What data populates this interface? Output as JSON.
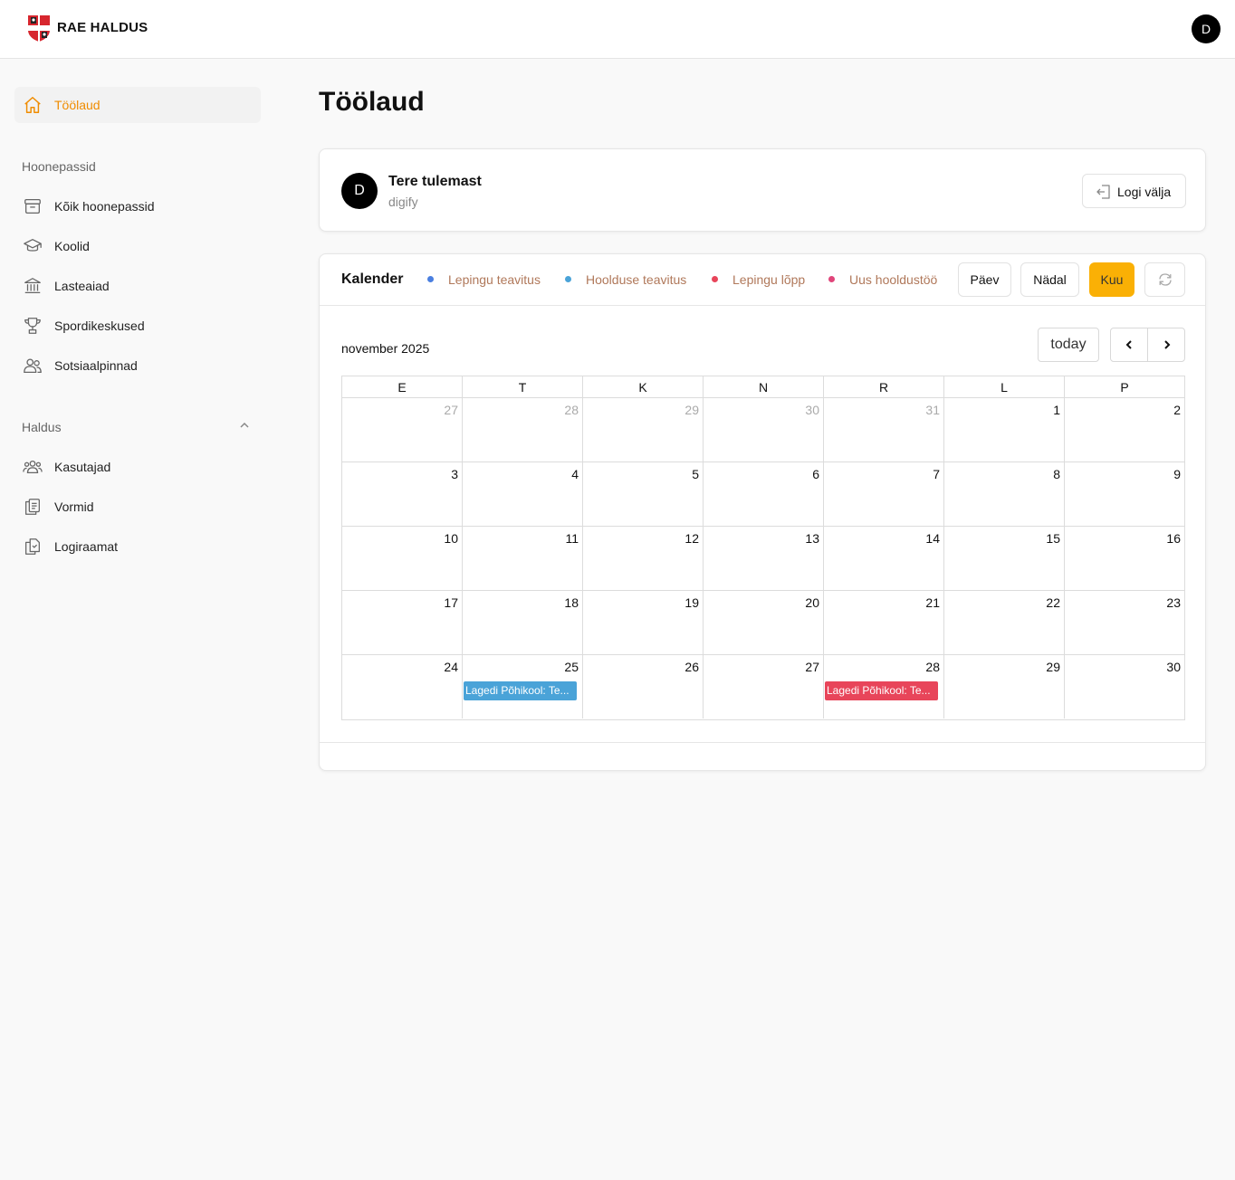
{
  "app": {
    "brand": "RAE HALDUS",
    "user_initial": "D"
  },
  "sidebar": {
    "active": {
      "label": "Töölaud",
      "icon": "home-icon"
    },
    "sections": [
      {
        "title": "Hoonepassid",
        "collapsible": false,
        "items": [
          {
            "label": "Kõik hoonepassid",
            "icon": "archive-box-icon"
          },
          {
            "label": "Koolid",
            "icon": "graduation-cap-icon"
          },
          {
            "label": "Lasteaiad",
            "icon": "building-columns-icon"
          },
          {
            "label": "Spordikeskused",
            "icon": "trophy-icon"
          },
          {
            "label": "Sotsiaalpinnad",
            "icon": "users-icon"
          }
        ]
      },
      {
        "title": "Haldus",
        "collapsible": true,
        "items": [
          {
            "label": "Kasutajad",
            "icon": "user-group-icon"
          },
          {
            "label": "Vormid",
            "icon": "clipboard-document-icon"
          },
          {
            "label": "Logiraamat",
            "icon": "document-duplicate-icon"
          }
        ]
      }
    ]
  },
  "main": {
    "title": "Töölaud",
    "welcome": {
      "avatar_initial": "D",
      "title": "Tere tulemast",
      "subtitle": "digify",
      "logout_label": "Logi välja"
    },
    "calendar": {
      "title": "Kalender",
      "legend": [
        {
          "label": "Lepingu teavitus",
          "color": "#4a7fe0"
        },
        {
          "label": "Hoolduse teavitus",
          "color": "#4aa3d8"
        },
        {
          "label": "Lepingu lõpp",
          "color": "#e8455a"
        },
        {
          "label": "Uus hooldustöö",
          "color": "#e0457a"
        }
      ],
      "views": [
        {
          "label": "Päev",
          "active": false
        },
        {
          "label": "Nädal",
          "active": false
        },
        {
          "label": "Kuu",
          "active": true
        }
      ],
      "accent_color": "#fab005",
      "month_label": "november 2025",
      "today_label": "today",
      "weekdays": [
        "E",
        "T",
        "K",
        "N",
        "R",
        "L",
        "P"
      ],
      "weeks": [
        [
          {
            "d": "27",
            "other": true
          },
          {
            "d": "28",
            "other": true
          },
          {
            "d": "29",
            "other": true
          },
          {
            "d": "30",
            "other": true
          },
          {
            "d": "31",
            "other": true
          },
          {
            "d": "1"
          },
          {
            "d": "2"
          }
        ],
        [
          {
            "d": "3"
          },
          {
            "d": "4"
          },
          {
            "d": "5"
          },
          {
            "d": "6"
          },
          {
            "d": "7"
          },
          {
            "d": "8"
          },
          {
            "d": "9"
          }
        ],
        [
          {
            "d": "10"
          },
          {
            "d": "11"
          },
          {
            "d": "12"
          },
          {
            "d": "13"
          },
          {
            "d": "14"
          },
          {
            "d": "15"
          },
          {
            "d": "16"
          }
        ],
        [
          {
            "d": "17"
          },
          {
            "d": "18"
          },
          {
            "d": "19"
          },
          {
            "d": "20"
          },
          {
            "d": "21"
          },
          {
            "d": "22"
          },
          {
            "d": "23"
          }
        ],
        [
          {
            "d": "24"
          },
          {
            "d": "25",
            "event": {
              "label": "Lagedi Põhikool: Te...",
              "color": "#4aa3d8"
            }
          },
          {
            "d": "26"
          },
          {
            "d": "27"
          },
          {
            "d": "28",
            "event": {
              "label": "Lagedi Põhikool: Te...",
              "color": "#e8455a"
            }
          },
          {
            "d": "29"
          },
          {
            "d": "30"
          }
        ]
      ]
    }
  }
}
